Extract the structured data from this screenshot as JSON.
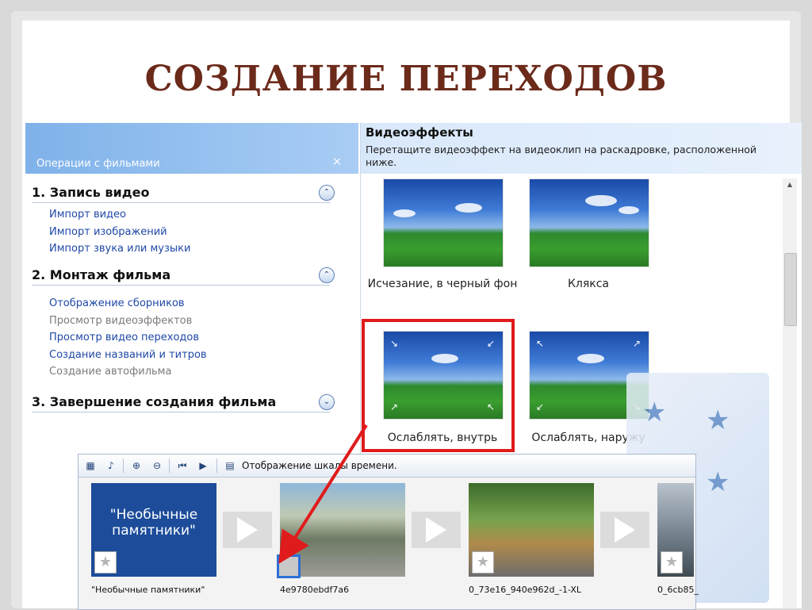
{
  "slide": {
    "title": "СОЗДАНИЕ ПЕРЕХОДОВ"
  },
  "taskpane": {
    "header": "Операции с фильмами",
    "close": "×",
    "sections": [
      {
        "title": "1. Запись видео",
        "toggle": "⌃",
        "links": [
          "Импорт видео",
          "Импорт изображений",
          "Импорт звука или музыки"
        ]
      },
      {
        "title": "2. Монтаж фильма",
        "toggle": "⌃",
        "links": [
          "Отображение сборников",
          "Просмотр видеоэффектов",
          "Просмотр видео переходов",
          "Создание названий и титров",
          "Создание автофильма"
        ]
      },
      {
        "title": "3. Завершение создания фильма",
        "toggle": "⌄",
        "links": []
      }
    ]
  },
  "effects": {
    "title": "Видеоэффекты",
    "description": "Перетащите видеоэффект на видеоклип на раскадровке, расположенной ниже.",
    "items": [
      {
        "label": "Исчезание, в черный фон"
      },
      {
        "label": "Клякса"
      },
      {
        "label": "Ослаблять, внутрь"
      },
      {
        "label": "Ослаблять, наружу"
      }
    ]
  },
  "storyboard": {
    "toolbar_label": "Отображение шкалы времени.",
    "title_clip_text": "\"Необычные памятники\"",
    "clips": [
      {
        "name": "\"Необычные памятники\""
      },
      {
        "name": "4e9780ebdf7a6"
      },
      {
        "name": "0_73e16_940e962d_-1-XL"
      },
      {
        "name": "0_6cb85_"
      }
    ]
  }
}
